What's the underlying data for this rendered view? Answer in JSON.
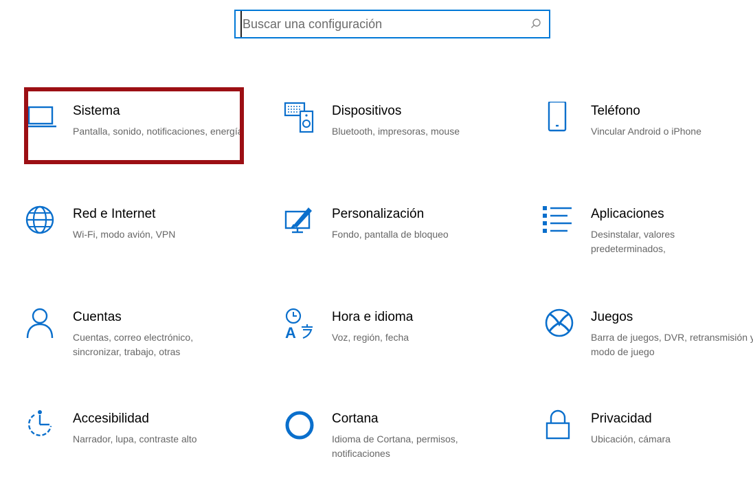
{
  "search": {
    "placeholder": "Buscar una configuración"
  },
  "tiles": [
    {
      "title": "Sistema",
      "description": "Pantalla, sonido, notificaciones, energía",
      "icon": "laptop-icon"
    },
    {
      "title": "Dispositivos",
      "description": "Bluetooth, impresoras, mouse",
      "icon": "devices-icon"
    },
    {
      "title": "Teléfono",
      "description": "Vincular Android o iPhone",
      "icon": "phone-icon"
    },
    {
      "title": "Red e Internet",
      "description": "Wi-Fi, modo avión, VPN",
      "icon": "globe-icon"
    },
    {
      "title": "Personalización",
      "description": "Fondo, pantalla de bloqueo",
      "icon": "personalization-icon"
    },
    {
      "title": "Aplicaciones",
      "description": "Desinstalar, valores predeterminados,",
      "icon": "apps-icon"
    },
    {
      "title": "Cuentas",
      "description": "Cuentas, correo electrónico, sincronizar, trabajo, otras",
      "icon": "person-icon"
    },
    {
      "title": "Hora e idioma",
      "description": "Voz, región, fecha",
      "icon": "time-language-icon"
    },
    {
      "title": "Juegos",
      "description": "Barra de juegos, DVR, retransmisión y modo de juego",
      "icon": "xbox-icon"
    },
    {
      "title": "Accesibilidad",
      "description": "Narrador, lupa, contraste alto",
      "icon": "accessibility-icon"
    },
    {
      "title": "Cortana",
      "description": "Idioma de Cortana, permisos, notificaciones",
      "icon": "cortana-icon"
    },
    {
      "title": "Privacidad",
      "description": "Ubicación, cámara",
      "icon": "lock-icon"
    }
  ],
  "colors": {
    "accent": "#0078d7",
    "highlight": "#9c0f14",
    "title": "#000000",
    "description": "#666666"
  }
}
